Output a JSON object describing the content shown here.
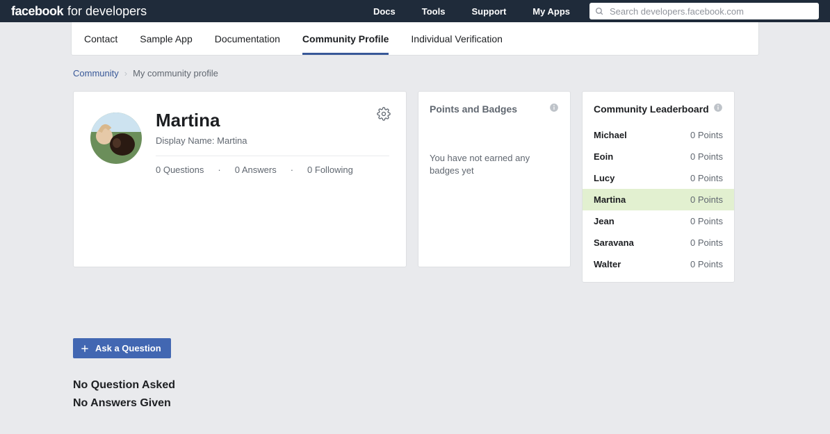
{
  "brand": {
    "fb": "facebook",
    "dev": "for developers"
  },
  "topnav": {
    "links": [
      "Docs",
      "Tools",
      "Support",
      "My Apps"
    ],
    "search_placeholder": "Search developers.facebook.com"
  },
  "tabs": {
    "items": [
      "Contact",
      "Sample App",
      "Documentation",
      "Community Profile",
      "Individual Verification"
    ],
    "active_index": 3
  },
  "breadcrumbs": {
    "root": "Community",
    "current": "My community profile"
  },
  "profile": {
    "name": "Martina",
    "display_name_label": "Display Name: Martina",
    "stats": {
      "questions": "0 Questions",
      "answers": "0 Answers",
      "following": "0 Following"
    }
  },
  "points_card": {
    "title": "Points and Badges",
    "message": "You have not earned any badges yet"
  },
  "leaderboard": {
    "title": "Community Leaderboard",
    "points_suffix": "Points",
    "rows": [
      {
        "name": "Michael",
        "points": 0,
        "me": false
      },
      {
        "name": "Eoin",
        "points": 0,
        "me": false
      },
      {
        "name": "Lucy",
        "points": 0,
        "me": false
      },
      {
        "name": "Martina",
        "points": 0,
        "me": true
      },
      {
        "name": "Jean",
        "points": 0,
        "me": false
      },
      {
        "name": "Saravana",
        "points": 0,
        "me": false
      },
      {
        "name": "Walter",
        "points": 0,
        "me": false
      }
    ]
  },
  "ask_button": "Ask a Question",
  "empty_states": {
    "no_questions": "No Question Asked",
    "no_answers": "No Answers Given"
  }
}
